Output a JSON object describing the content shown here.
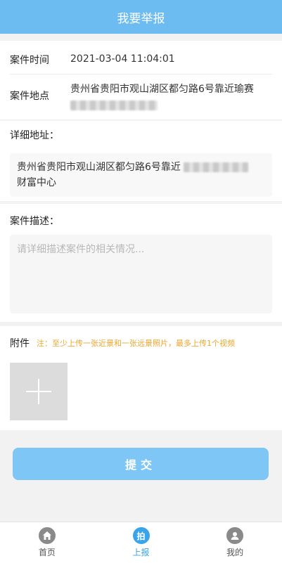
{
  "header": {
    "title": "我要举报"
  },
  "case": {
    "time_label": "案件时间",
    "time_value": "2021-03-04 11:04:01",
    "location_label": "案件地点",
    "location_value": "贵州省贵阳市观山湖区都匀路6号靠近瑜赛"
  },
  "detail": {
    "label": "详细地址：",
    "line1": "贵州省贵阳市观山湖区都匀路6号靠近",
    "line2": "财富中心"
  },
  "description": {
    "label": "案件描述：",
    "placeholder": "请详细描述案件的相关情况..."
  },
  "attachment": {
    "label": "附件",
    "note": "注：至少上传一张近景和一张远景照片，最多上传1个视频"
  },
  "submit": {
    "label": "提交"
  },
  "tabbar": {
    "items": [
      {
        "label": "首页",
        "icon": "home-icon"
      },
      {
        "label": "上报",
        "icon": "report-icon",
        "glyph": "拍"
      },
      {
        "label": "我的",
        "icon": "user-icon"
      }
    ]
  },
  "colors": {
    "primary": "#6cbcf1",
    "button": "#7ec6f5",
    "note": "#f0a52b",
    "tab_active": "#3aa4ea"
  }
}
